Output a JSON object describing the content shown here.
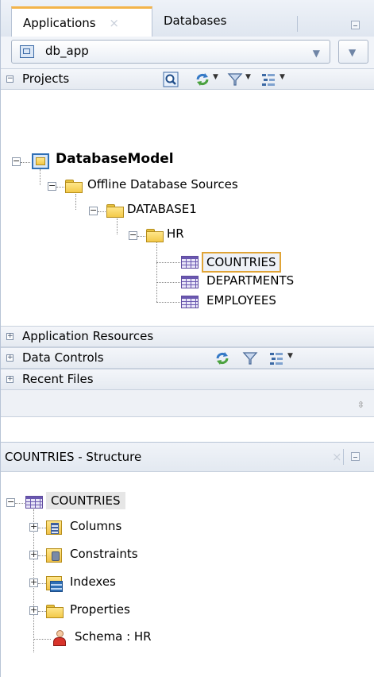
{
  "tabs": [
    {
      "label": "Applications",
      "active": true
    },
    {
      "label": "Databases",
      "active": false
    }
  ],
  "app_selector": {
    "value": "db_app"
  },
  "sections": {
    "projects": "Projects",
    "application_resources": "Application Resources",
    "data_controls": "Data Controls",
    "recent_files": "Recent Files"
  },
  "tree": {
    "model": "DatabaseModel",
    "offline_sources": "Offline Database Sources",
    "database": "DATABASE1",
    "schema": "HR",
    "tables": [
      "COUNTRIES",
      "DEPARTMENTS",
      "EMPLOYEES"
    ]
  },
  "structure": {
    "title": "COUNTRIES - Structure",
    "root": "COUNTRIES",
    "items": [
      "Columns",
      "Constraints",
      "Indexes",
      "Properties",
      "Schema : HR"
    ]
  },
  "colors": {
    "accent": "#f3b44a",
    "selection_border": "#e0a437"
  }
}
